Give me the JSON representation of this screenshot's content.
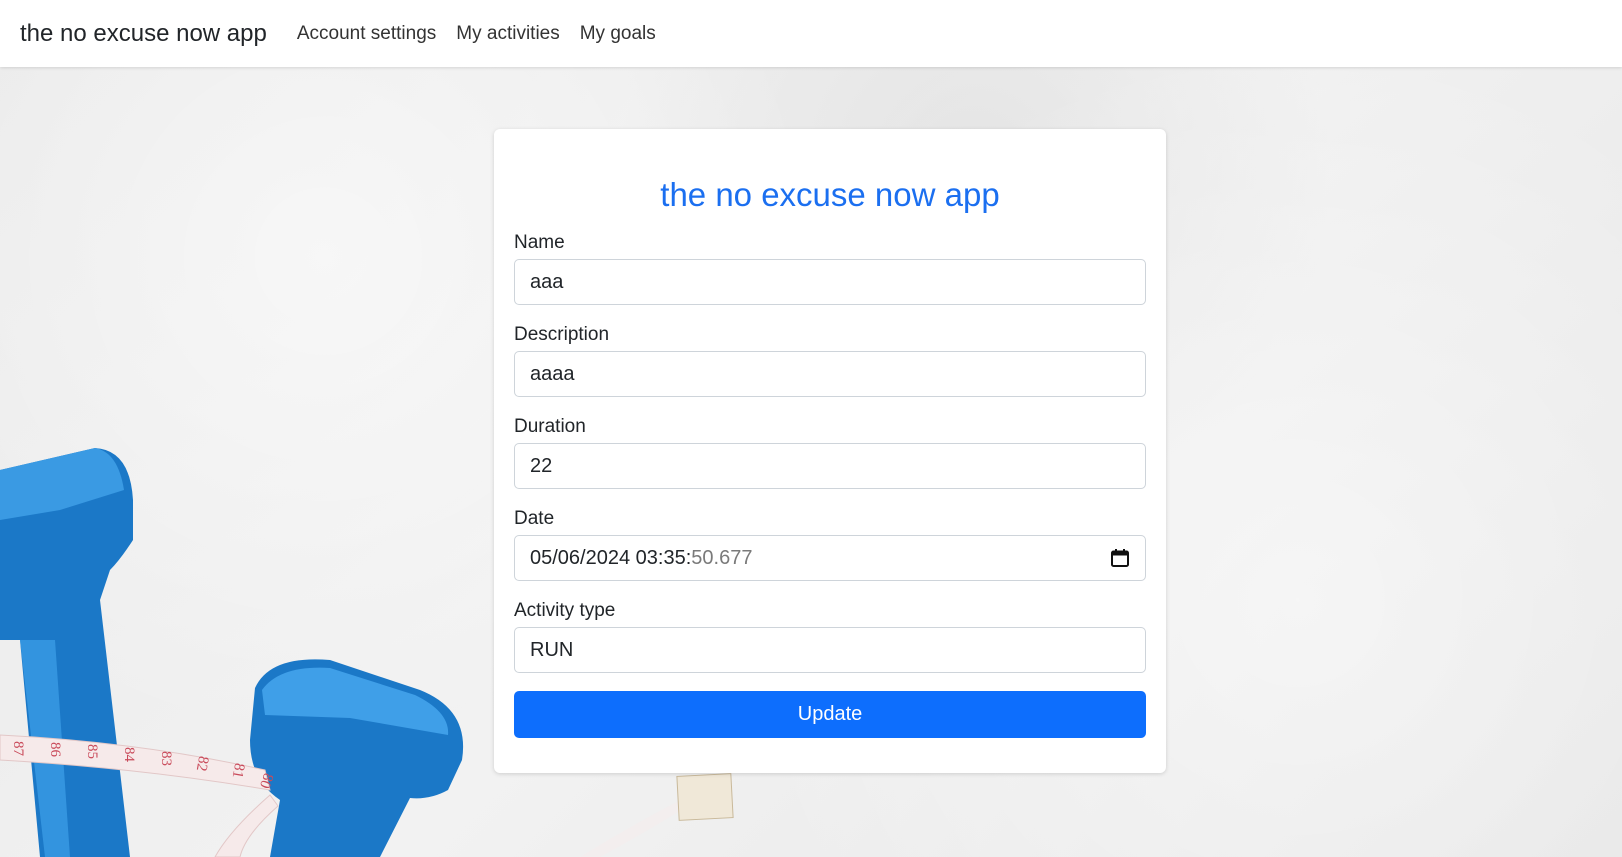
{
  "nav": {
    "brand": "the no excuse now app",
    "links": [
      "Account settings",
      "My activities",
      "My goals"
    ]
  },
  "form": {
    "title": "the no excuse now app",
    "fields": [
      {
        "label": "Name",
        "value": "aaa"
      },
      {
        "label": "Description",
        "value": "aaaa"
      },
      {
        "label": "Duration",
        "value": "22"
      },
      {
        "label": "Date",
        "value_main": "05/06/2024 03:35:",
        "value_dim": "50.677"
      },
      {
        "label": "Activity type",
        "value": "RUN"
      }
    ],
    "submit_label": "Update"
  },
  "colors": {
    "title": "#1b6ff0",
    "button": "#0d6efd",
    "dumbbell": "#1a7fd0"
  },
  "icons": {
    "date": "calendar-icon"
  },
  "tape_numbers": [
    "87",
    "86",
    "85",
    "84",
    "83",
    "82",
    "81",
    "80"
  ]
}
